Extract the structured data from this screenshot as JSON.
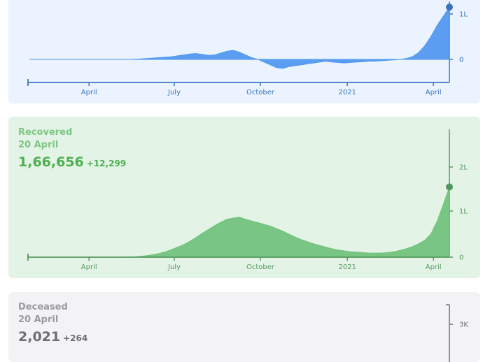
{
  "chart_data": [
    {
      "type": "area",
      "title": "",
      "x_labels": [
        "April",
        "July",
        "October",
        "2021",
        "April"
      ],
      "y_ticks": [
        "1L",
        "0"
      ],
      "ylim": [
        -30000,
        120000
      ],
      "marker_value": 115000,
      "color": "#4a94f0",
      "series": [
        {
          "values": [
            0,
            0,
            0,
            0,
            0,
            0,
            0,
            0,
            0,
            0,
            0,
            0,
            0,
            0,
            0,
            0,
            0,
            500,
            1000,
            2000,
            3000,
            4000,
            5000,
            6000,
            8000,
            10000,
            12000,
            13000,
            11000,
            9000,
            10000,
            14000,
            18000,
            20000,
            16000,
            10000,
            4000,
            0,
            -6000,
            -12000,
            -18000,
            -20000,
            -16000,
            -14000,
            -12000,
            -10000,
            -8000,
            -6000,
            -4000,
            -6000,
            -7000,
            -8000,
            -7000,
            -6000,
            -5000,
            -4000,
            -4000,
            -3000,
            -2000,
            -1000,
            0,
            2000,
            6000,
            15000,
            30000,
            50000,
            75000,
            95000,
            115000
          ]
        }
      ]
    },
    {
      "type": "area",
      "title": "Recovered",
      "date": "20 April",
      "value": "1,66,656",
      "delta": "+12,299",
      "x_labels": [
        "April",
        "July",
        "October",
        "2021",
        "April"
      ],
      "y_ticks": [
        "2L",
        "1L",
        "0"
      ],
      "ylim": [
        0,
        300000
      ],
      "marker_value": 166656,
      "color": "#6cc079",
      "series": [
        {
          "values": [
            0,
            0,
            0,
            0,
            0,
            0,
            0,
            0,
            0,
            0,
            0,
            0,
            0,
            0,
            0,
            200,
            500,
            1000,
            2000,
            4000,
            6000,
            9000,
            13000,
            18000,
            24000,
            30000,
            38000,
            47000,
            57000,
            66000,
            75000,
            83000,
            90000,
            93000,
            95000,
            90000,
            86000,
            82000,
            78000,
            74000,
            68000,
            62000,
            55000,
            48000,
            42000,
            37000,
            32000,
            28000,
            24000,
            20000,
            17000,
            15000,
            13000,
            12000,
            11000,
            10000,
            10000,
            10000,
            11000,
            13000,
            16000,
            20000,
            25000,
            32000,
            40000,
            55000,
            85000,
            125000,
            166656
          ]
        }
      ]
    },
    {
      "type": "area",
      "title": "Deceased",
      "date": "20 April",
      "value": "2,021",
      "delta": "+264",
      "y_ticks": [
        "3K"
      ],
      "color": "#8c8c92"
    }
  ]
}
